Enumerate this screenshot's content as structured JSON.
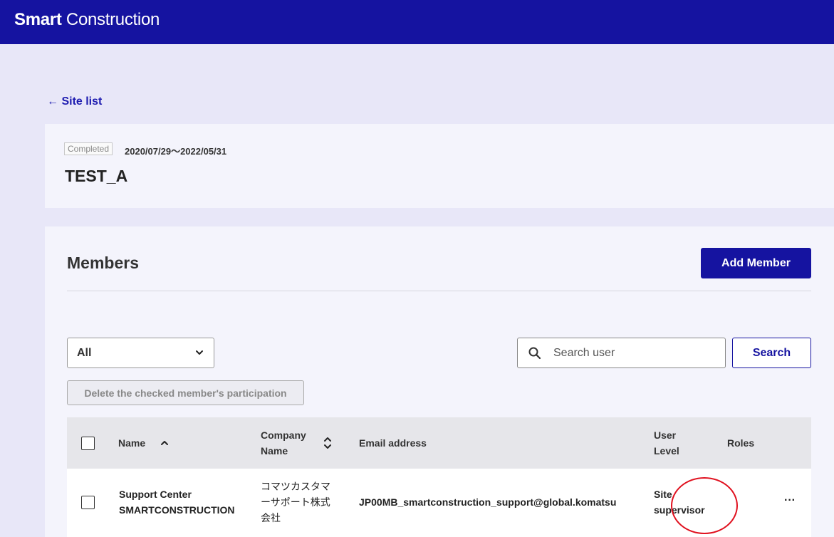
{
  "header": {
    "brand_bold": "Smart",
    "brand_rest": "Construction"
  },
  "back_link": "← Site list",
  "site": {
    "status": "Completed",
    "dates": "2020/07/29～2022/05/31",
    "name": "TEST_A"
  },
  "members": {
    "title": "Members",
    "add_label": "Add Member",
    "filter_value": "All",
    "search_placeholder": "Search user",
    "search_label": "Search",
    "delete_label": "Delete the checked member's participation",
    "columns": {
      "name": "Name",
      "company_line1": "Company",
      "company_line2": "Name",
      "email": "Email address",
      "level_line1": "User",
      "level_line2": "Level",
      "roles": "Roles"
    },
    "rows": [
      {
        "name_line1": "Support Center",
        "name_line2": "SMARTCONSTRUCTION",
        "company_line1": "コマツカスタマ",
        "company_line2": "ーサポート株式",
        "company_line3": "会社",
        "email": "JP00MB_smartconstruction_support@global.komatsu",
        "level_line1": "Site",
        "level_line2": "supervisor",
        "roles": "",
        "more": "···"
      }
    ]
  },
  "colors": {
    "brand": "#1513a0",
    "highlight_circle": "#e0101e"
  }
}
